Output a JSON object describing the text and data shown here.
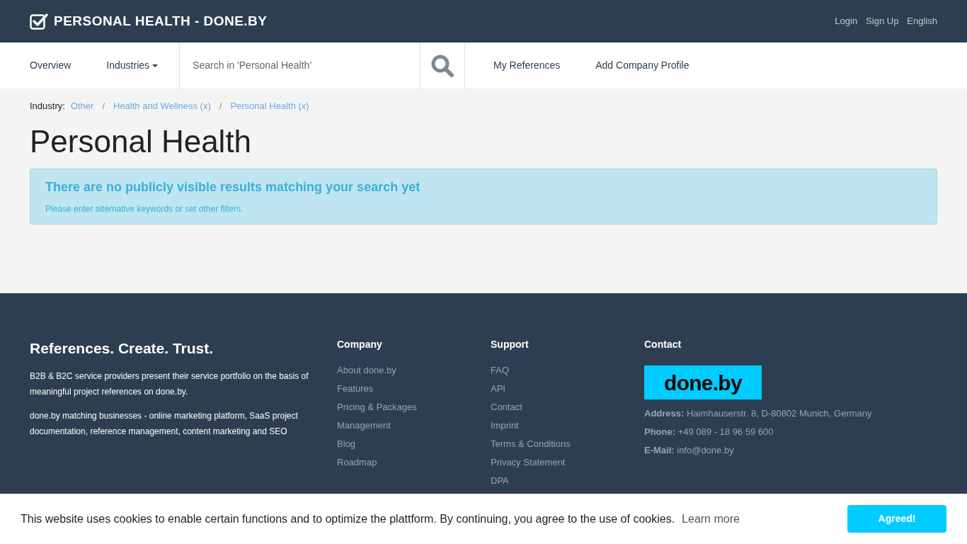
{
  "header": {
    "title": "PERSONAL HEALTH - DONE.BY",
    "links": [
      "Login",
      "Sign Up",
      "English"
    ]
  },
  "nav": {
    "items": [
      {
        "label": "Overview",
        "kind": "link"
      },
      {
        "label": "Industries",
        "kind": "dropdown"
      }
    ],
    "search": {
      "placeholder": "Search in 'Personal Health'"
    },
    "right_items": [
      "My References",
      "Add Company Profile"
    ]
  },
  "breadcrumb": {
    "label": "Industry:",
    "separator": "/",
    "items": [
      "Other",
      "Health and Wellness (x)",
      "Personal Health (x)"
    ]
  },
  "page_title": "Personal Health",
  "alert": {
    "title": "There are no publicly visible results matching your search yet",
    "text": "Please enter alternative keywords or set other filters."
  },
  "footer": {
    "tagline": "References. Create. Trust.",
    "paragraphs": [
      "B2B & B2C service providers present their service portfolio on the basis of meaningful project references on done.by.",
      "done.by matching businesses - online marketing platform, SaaS project documentation, reference management, content marketing and SEO"
    ],
    "columns": [
      {
        "title": "Company",
        "links": [
          "About done.by",
          "Features",
          "Pricing & Packages",
          "Management",
          "Blog",
          "Roadmap"
        ]
      },
      {
        "title": "Support",
        "links": [
          "FAQ",
          "API",
          "Contact",
          "Imprint",
          "Terms & Conditions",
          "Privacy Statement",
          "DPA"
        ]
      }
    ],
    "contact": {
      "title": "Contact",
      "logo": "done.by",
      "lines": [
        "**Address:** Haimhauserstr. 8, D-80802 Munich, Germany",
        "**Phone:** +49 089 - 18 96 59 600",
        "**E-Mail:** info@done.by"
      ]
    }
  },
  "cookie_banner": {
    "text": "This website uses cookies to enable certain functions and to optimize the plattform. By continuing, you agree to the use of cookies.",
    "link": "Learn more",
    "button": "Agreed!"
  }
}
